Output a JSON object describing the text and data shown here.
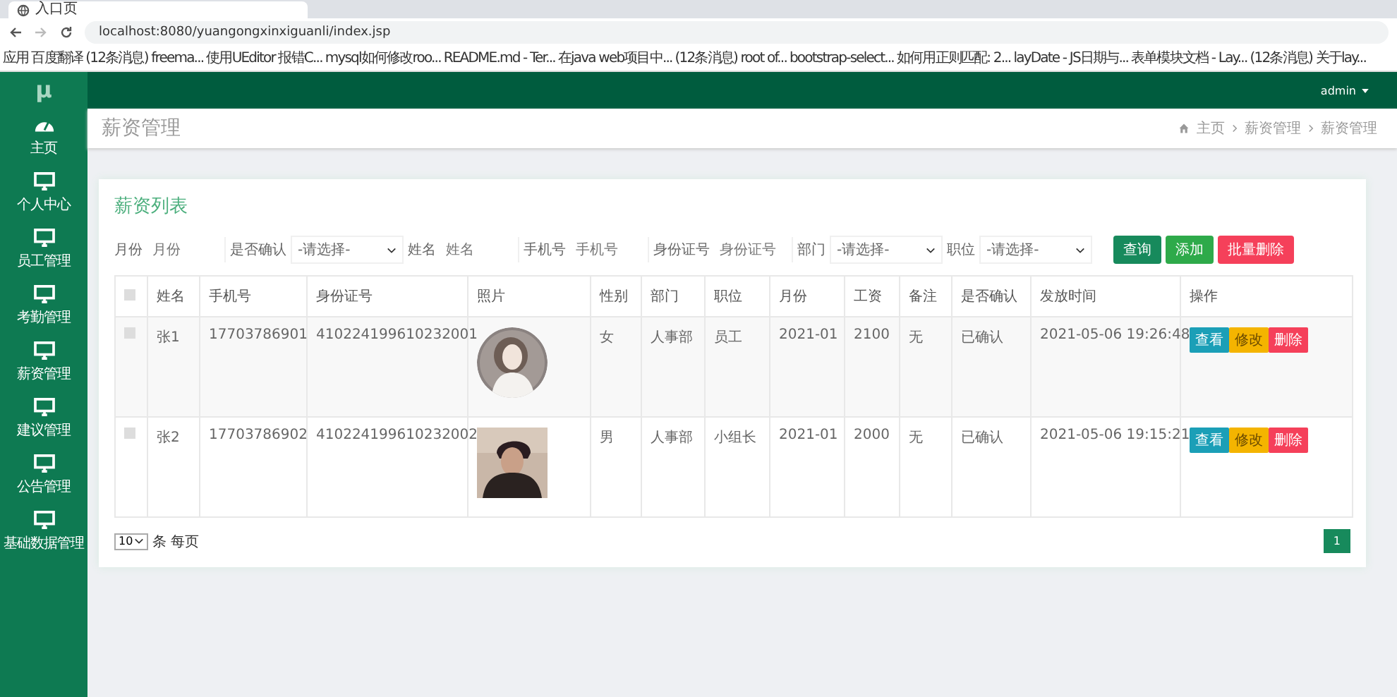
{
  "browser": {
    "tab_title": "入口页",
    "url": "localhost:8080/yuangongxinxiguanli/index.jsp",
    "bookmarks": [
      "应用",
      "百度翻译",
      "(12条消息) freema...",
      "使用UEditor 报错C...",
      "mysql如何修改roo...",
      "README.md - Ter...",
      "在java web项目中...",
      "(12条消息) root of...",
      "bootstrap-select...",
      "如何用正则匹配: 2...",
      "layDate - JS日期与...",
      "表单模块文档 - Lay...",
      "(12条消息) 关于lay..."
    ]
  },
  "app": {
    "logo": "μ",
    "user": "admin"
  },
  "sidebar": {
    "items": [
      {
        "label": "主页",
        "kind": "dashboard"
      },
      {
        "label": "个人中心",
        "kind": "monitor"
      },
      {
        "label": "员工管理",
        "kind": "monitor"
      },
      {
        "label": "考勤管理",
        "kind": "monitor"
      },
      {
        "label": "薪资管理",
        "kind": "monitor"
      },
      {
        "label": "建议管理",
        "kind": "monitor"
      },
      {
        "label": "公告管理",
        "kind": "monitor"
      },
      {
        "label": "基础数据管理",
        "kind": "monitor"
      }
    ]
  },
  "header": {
    "title": "薪资管理",
    "breadcrumb": [
      "主页",
      "薪资管理",
      "薪资管理"
    ]
  },
  "card": {
    "title": "薪资列表",
    "filters": [
      {
        "kind": "input",
        "label": "月份",
        "placeholder": "月份"
      },
      {
        "kind": "select",
        "label": "是否确认",
        "value": "-请选择-"
      },
      {
        "kind": "input",
        "label": "姓名",
        "placeholder": "姓名"
      },
      {
        "kind": "input",
        "label": "手机号",
        "placeholder": "手机号"
      },
      {
        "kind": "input",
        "label": "身份证号",
        "placeholder": "身份证号"
      },
      {
        "kind": "select",
        "label": "部门",
        "value": "-请选择-"
      },
      {
        "kind": "select",
        "label": "职位",
        "value": "-请选择-"
      }
    ],
    "buttons": [
      {
        "label": "查询",
        "kind": "query"
      },
      {
        "label": "添加",
        "kind": "add"
      },
      {
        "label": "批量删除",
        "kind": "delete"
      }
    ]
  },
  "table": {
    "all_checked": false,
    "columns": [
      "姓名",
      "手机号",
      "身份证号",
      "照片",
      "性别",
      "部门",
      "职位",
      "月份",
      "工资",
      "备注",
      "是否确认",
      "发放时间",
      "操作"
    ],
    "rows": [
      {
        "checked": false,
        "name": "张1",
        "phone": "17703786901",
        "id_number": "410224199610232001",
        "photo": {
          "kind": "round"
        },
        "gender": "女",
        "department": "人事部",
        "position": "员工",
        "month": "2021-01",
        "salary": "2100",
        "remark": "无",
        "confirmed": "已确认",
        "issued_at": "2021-05-06 19:26:48",
        "actions": [
          {
            "label": "查看",
            "kind": "view"
          },
          {
            "label": "修改",
            "kind": "edit"
          },
          {
            "label": "删除",
            "kind": "delete"
          }
        ]
      },
      {
        "checked": false,
        "name": "张2",
        "phone": "17703786902",
        "id_number": "410224199610232002",
        "photo": {
          "kind": "square"
        },
        "gender": "男",
        "department": "人事部",
        "position": "小组长",
        "month": "2021-01",
        "salary": "2000",
        "remark": "无",
        "confirmed": "已确认",
        "issued_at": "2021-05-06 19:15:21",
        "actions": [
          {
            "label": "查看",
            "kind": "view"
          },
          {
            "label": "修改",
            "kind": "edit"
          },
          {
            "label": "删除",
            "kind": "delete"
          }
        ]
      }
    ]
  },
  "footer": {
    "page_size": "10",
    "page_size_suffix": "条 每页",
    "pages": [
      {
        "label": "1",
        "selected": true
      }
    ]
  }
}
